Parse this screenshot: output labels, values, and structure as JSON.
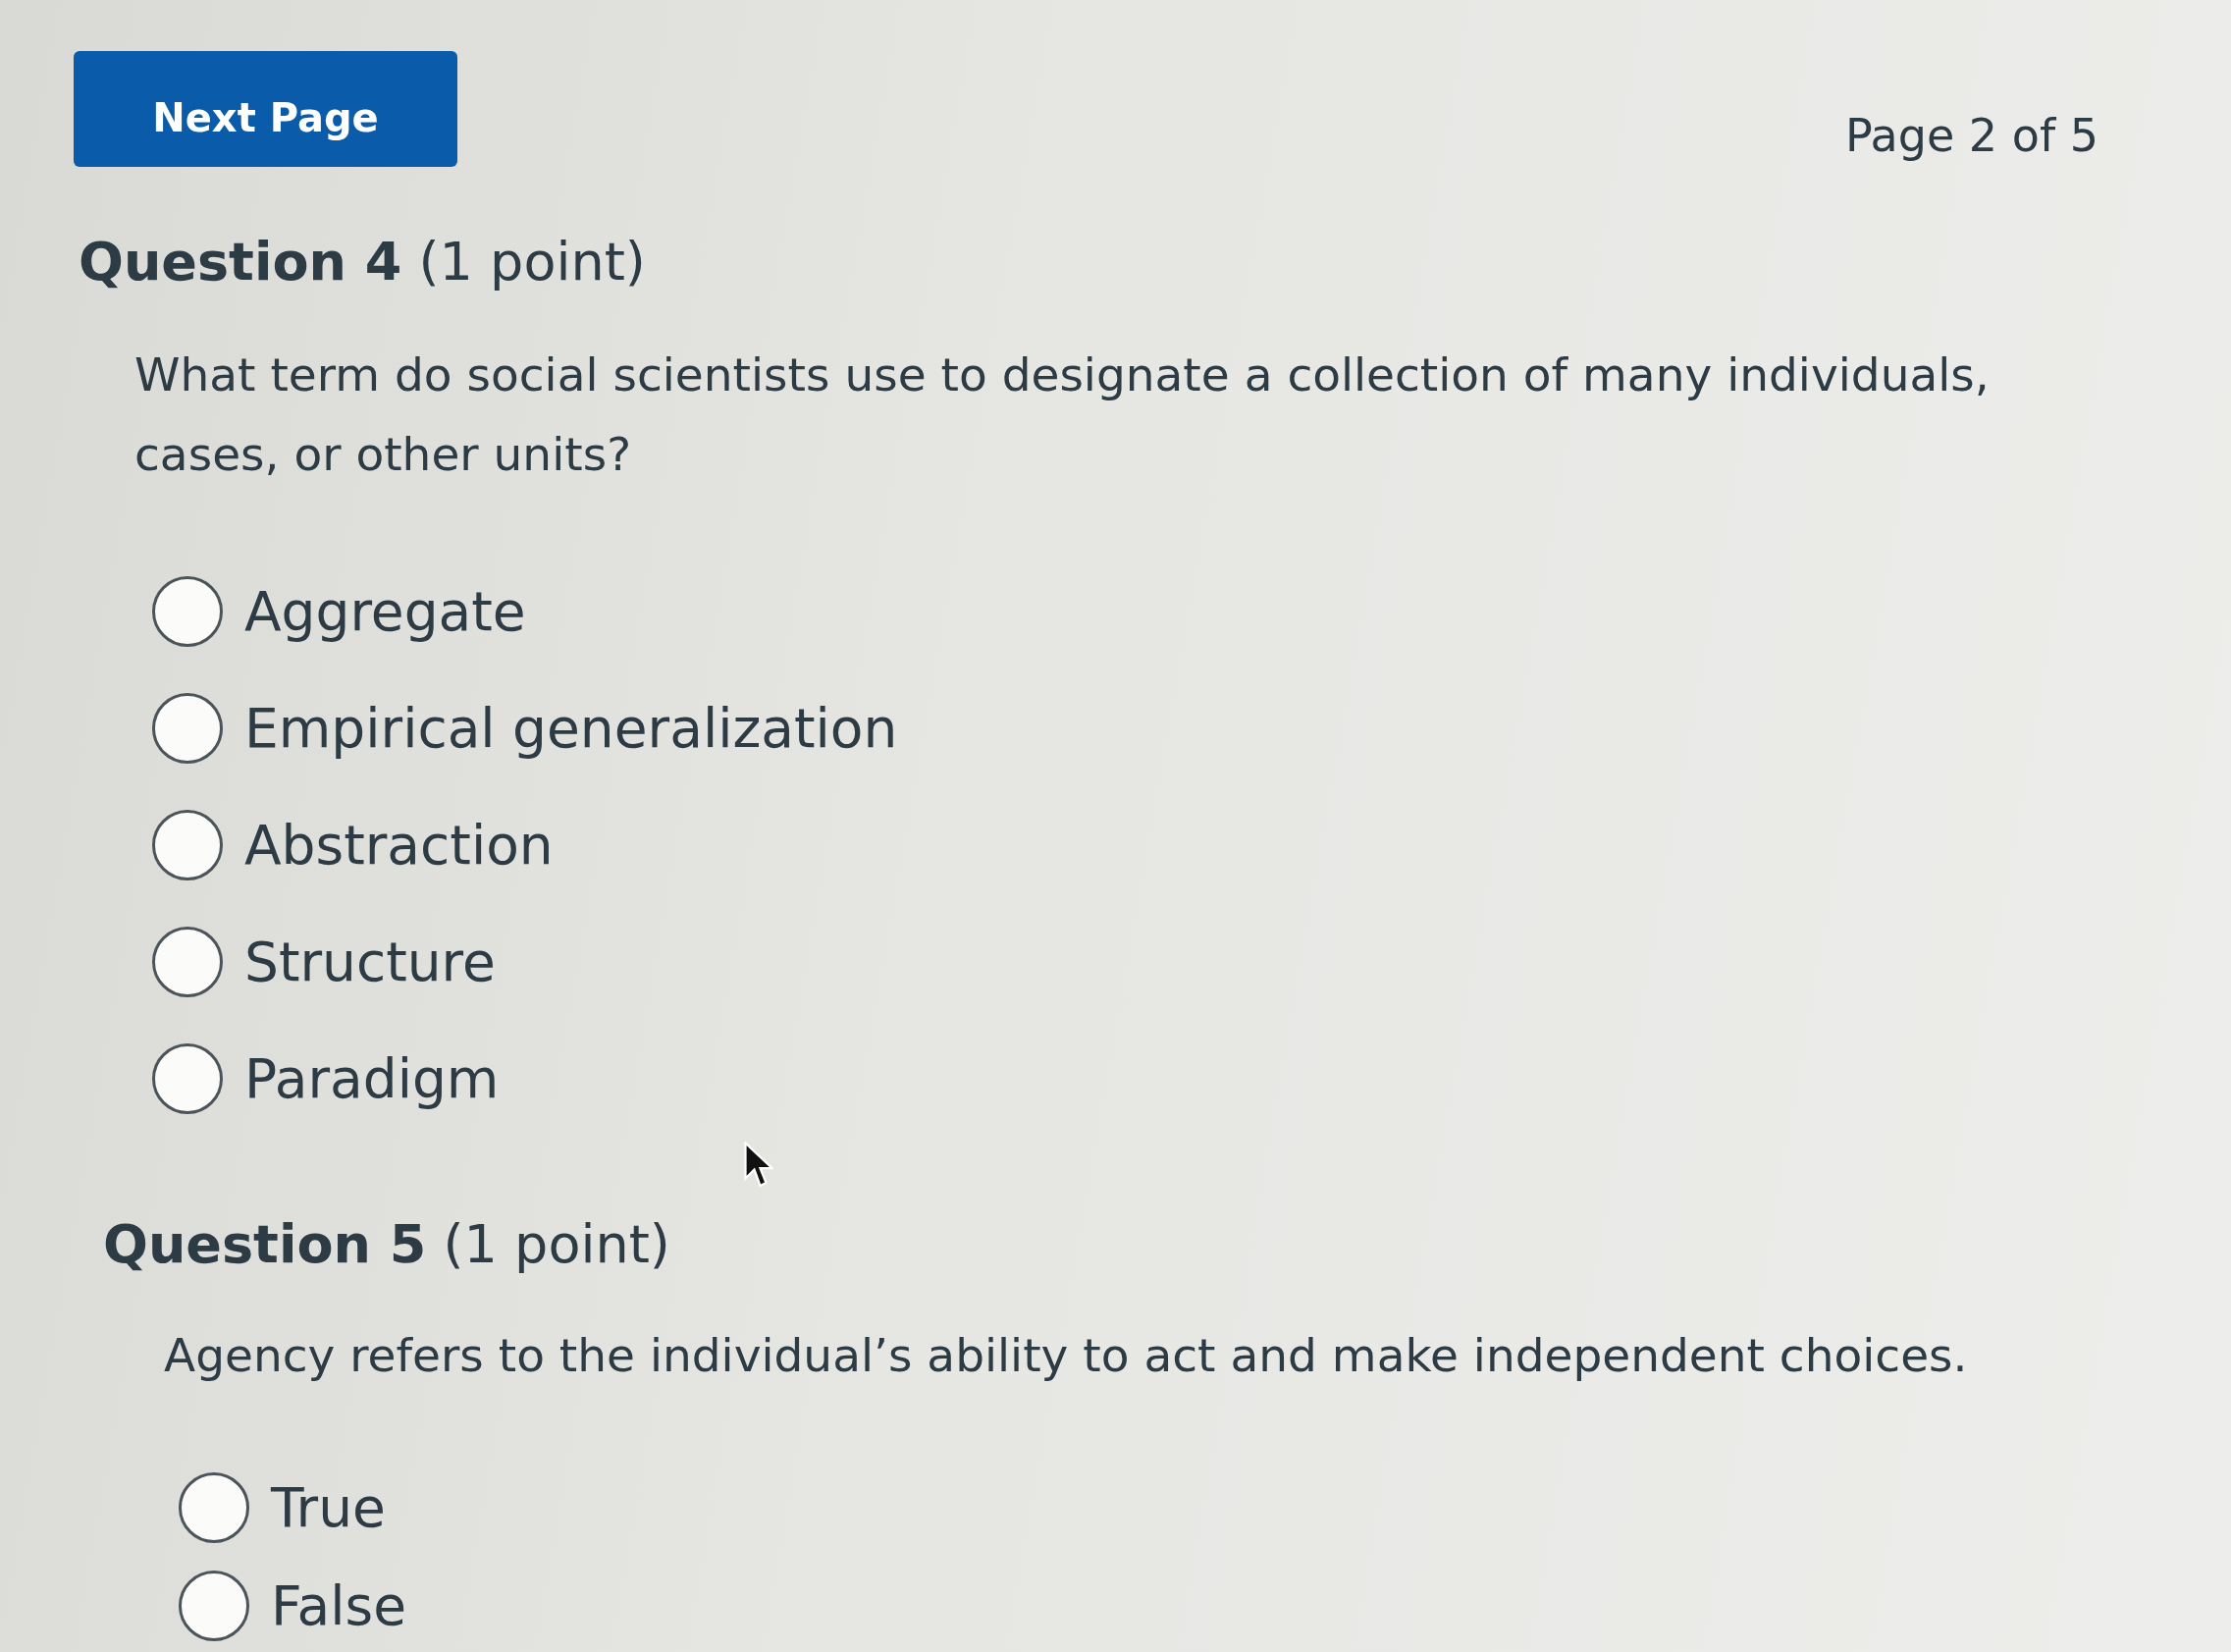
{
  "header": {
    "next_button": "Next Page",
    "page_indicator": "Page 2 of 5"
  },
  "questions": [
    {
      "heading": "**Question 4** (1 point)",
      "prompt": "What term do social scientists use to designate a collection of many individuals, cases, or other units?",
      "options": [
        {
          "label": "Aggregate",
          "selected": false
        },
        {
          "label": "Empirical generalization",
          "selected": false
        },
        {
          "label": "Abstraction",
          "selected": false
        },
        {
          "label": "Structure",
          "selected": false
        },
        {
          "label": "Paradigm",
          "selected": false
        }
      ]
    },
    {
      "heading": "**Question 5** (1 point)",
      "prompt": "Agency refers to the individual’s ability to act and make independent choices.",
      "options": [
        {
          "label": "True",
          "selected": false
        },
        {
          "label": "False",
          "selected": false
        }
      ]
    }
  ]
}
